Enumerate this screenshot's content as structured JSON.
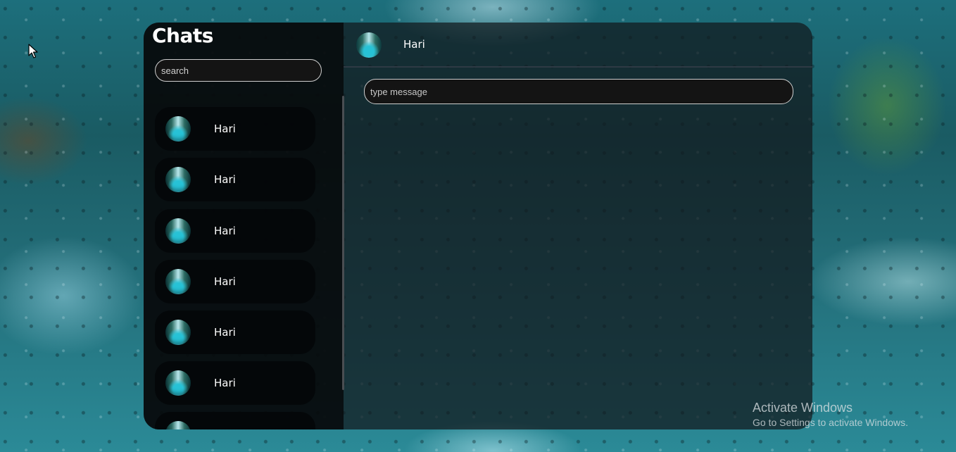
{
  "sidebar": {
    "title": "Chats",
    "search": {
      "placeholder": "search",
      "value": ""
    },
    "items": [
      {
        "name": "Hari",
        "avatar": "avatar-photo-icon"
      },
      {
        "name": "Hari",
        "avatar": "avatar-photo-icon"
      },
      {
        "name": "Hari",
        "avatar": "avatar-photo-icon"
      },
      {
        "name": "Hari",
        "avatar": "avatar-photo-icon"
      },
      {
        "name": "Hari",
        "avatar": "avatar-photo-icon"
      },
      {
        "name": "Hari",
        "avatar": "avatar-photo-icon"
      },
      {
        "name": "",
        "avatar": "avatar-photo-icon"
      }
    ]
  },
  "conversation": {
    "header": {
      "name": "Hari",
      "avatar": "avatar-photo-icon"
    },
    "composer": {
      "placeholder": "type message",
      "value": ""
    }
  },
  "system": {
    "watermark_title": "Activate Windows",
    "watermark_subtitle": "Go to Settings to activate Windows.",
    "cursor_icon": "mouse-pointer-icon"
  },
  "colors": {
    "panel_bg": "#12181c",
    "sidebar_bg": "#06080a",
    "input_border": "#cfcfcf",
    "text": "#ffffff"
  }
}
